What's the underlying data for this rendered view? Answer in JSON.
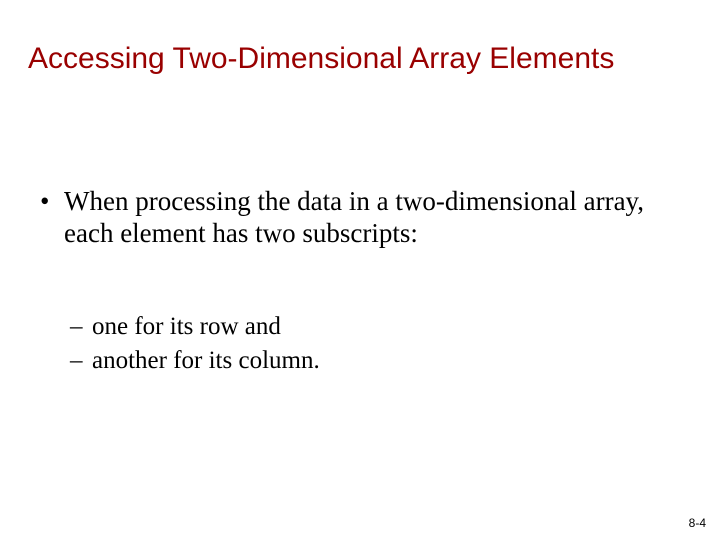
{
  "title": "Accessing Two-Dimensional Array Elements",
  "bullets": {
    "main": "When processing the data in a two-dimensional array, each element has two subscripts:",
    "sub1": "one for its row and",
    "sub2": "another for its column."
  },
  "footer": "8-4"
}
